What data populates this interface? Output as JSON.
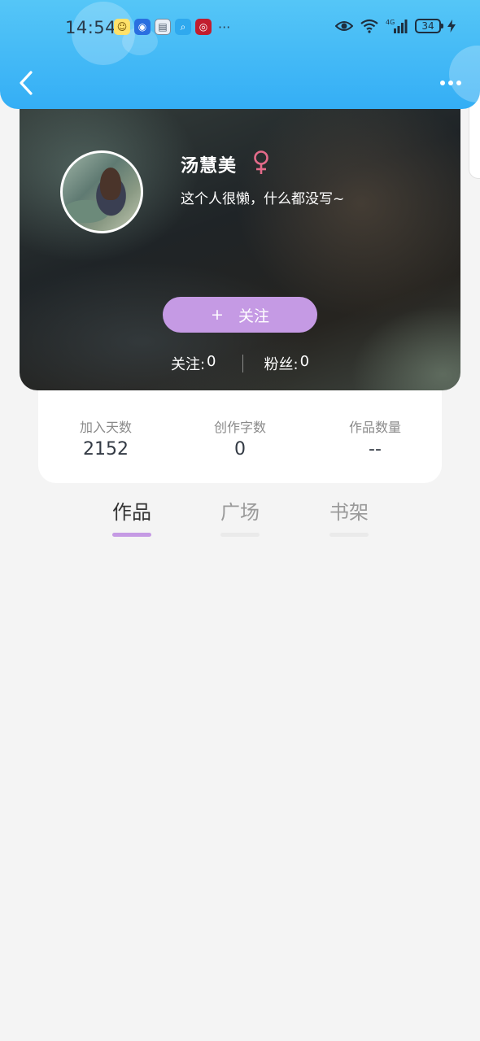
{
  "status_bar": {
    "time": "14:54",
    "more_indicator": "···",
    "battery_level": "34",
    "network_label": "4G"
  },
  "nav": {
    "back_icon": "chevron-left-icon",
    "more_icon": "more-dots-icon"
  },
  "profile": {
    "name": "汤慧美",
    "gender_icon": "female-icon",
    "gender_color": "#e46b8a",
    "bio": "这个人很懒，什么都没写~",
    "follow_plus": "+",
    "follow_label": "关注",
    "following_label": "关注:",
    "following_count": "0",
    "followers_label": "粉丝:",
    "followers_count": "0",
    "accent_color": "#c59ae4"
  },
  "stats": [
    {
      "label": "加入天数",
      "value": "2152"
    },
    {
      "label": "创作字数",
      "value": "0"
    },
    {
      "label": "作品数量",
      "value": "--"
    }
  ],
  "tabs": [
    {
      "label": "作品",
      "active": true
    },
    {
      "label": "广场",
      "active": false
    },
    {
      "label": "书架",
      "active": false
    }
  ],
  "colors": {
    "header_blue": "#34aef5",
    "page_background": "#f4f4f4"
  }
}
